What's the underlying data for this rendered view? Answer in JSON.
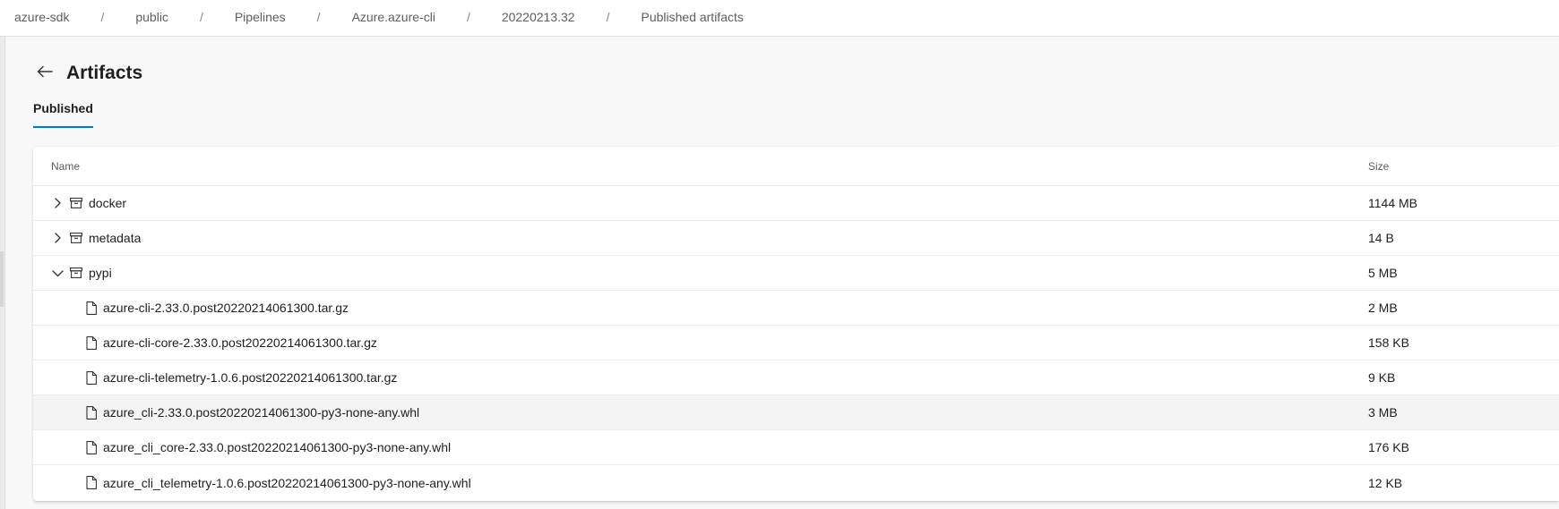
{
  "breadcrumb": [
    {
      "label": "azure-sdk"
    },
    {
      "label": "public"
    },
    {
      "label": "Pipelines"
    },
    {
      "label": "Azure.azure-cli"
    },
    {
      "label": "20220213.32"
    },
    {
      "label": "Published artifacts"
    }
  ],
  "breadcrumb_separator": "/",
  "page": {
    "title": "Artifacts"
  },
  "tabs": [
    {
      "label": "Published",
      "selected": true
    }
  ],
  "table": {
    "columns": {
      "name": "Name",
      "size": "Size"
    },
    "rows": [
      {
        "type": "folder",
        "expanded": false,
        "name": "docker",
        "size": "1144 MB"
      },
      {
        "type": "folder",
        "expanded": false,
        "name": "metadata",
        "size": "14 B"
      },
      {
        "type": "folder",
        "expanded": true,
        "name": "pypi",
        "size": "5 MB"
      },
      {
        "type": "file",
        "name": "azure-cli-2.33.0.post20220214061300.tar.gz",
        "size": "2 MB"
      },
      {
        "type": "file",
        "name": "azure-cli-core-2.33.0.post20220214061300.tar.gz",
        "size": "158 KB"
      },
      {
        "type": "file",
        "name": "azure-cli-telemetry-1.0.6.post20220214061300.tar.gz",
        "size": "9 KB"
      },
      {
        "type": "file",
        "name": "azure_cli-2.33.0.post20220214061300-py3-none-any.whl",
        "size": "3 MB",
        "hovered": true
      },
      {
        "type": "file",
        "name": "azure_cli_core-2.33.0.post20220214061300-py3-none-any.whl",
        "size": "176 KB"
      },
      {
        "type": "file",
        "name": "azure_cli_telemetry-1.0.6.post20220214061300-py3-none-any.whl",
        "size": "12 KB"
      }
    ]
  },
  "icons": {
    "back": "arrow-left-icon",
    "collapsed": "chevron-right-icon",
    "expanded": "chevron-down-icon",
    "folder": "artifact-folder-icon",
    "file": "file-icon"
  },
  "colors": {
    "accent": "#0078d4",
    "background": "#f8f8f8",
    "hover_row": "#f4f4f4"
  }
}
